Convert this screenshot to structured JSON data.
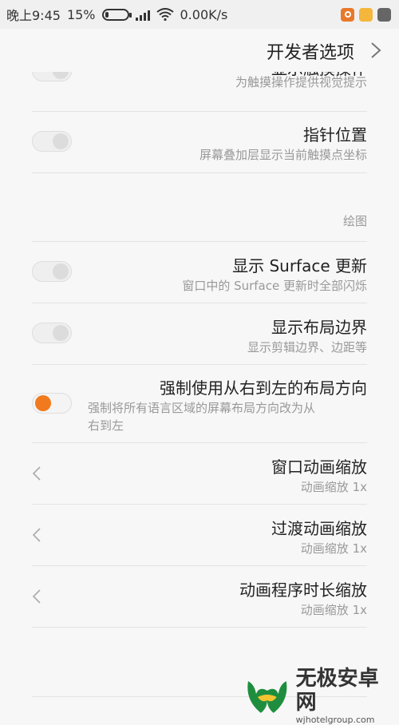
{
  "status_bar": {
    "time": "晚上9:45",
    "battery": "15%",
    "network_speed": "0.00K/s"
  },
  "header": {
    "title": "开发者选项"
  },
  "items": [
    {
      "title": "显示触摸操作",
      "subtitle": "为触摸操作提供视觉提示",
      "toggle_on": false
    },
    {
      "title": "指针位置",
      "subtitle": "屏幕叠加层显示当前触摸点坐标",
      "toggle_on": false
    },
    {
      "title": "显示 Surface 更新",
      "subtitle": "窗口中的 Surface 更新时全部闪烁",
      "toggle_on": false
    },
    {
      "title": "显示布局边界",
      "subtitle": "显示剪辑边界、边距等",
      "toggle_on": false
    },
    {
      "title": "强制使用从右到左的布局方向",
      "subtitle_line1": "强制将所有语言区域的屏幕布局方向改为从",
      "subtitle_line2": "右到左",
      "toggle_on": true
    },
    {
      "title": "窗口动画缩放",
      "subtitle": "动画缩放 1x"
    },
    {
      "title": "过渡动画缩放",
      "subtitle": "动画缩放 1x"
    },
    {
      "title": "动画程序时长缩放",
      "subtitle": "动画缩放 1x"
    }
  ],
  "section": {
    "drawing_label": "绘图"
  },
  "watermark": {
    "name": "无极安卓网",
    "url": "wjhotelgroup.com"
  },
  "colors": {
    "accent": "#f07a1d",
    "status_bar_bg": "#f0f0f0",
    "page_bg": "#f7f7f7"
  }
}
